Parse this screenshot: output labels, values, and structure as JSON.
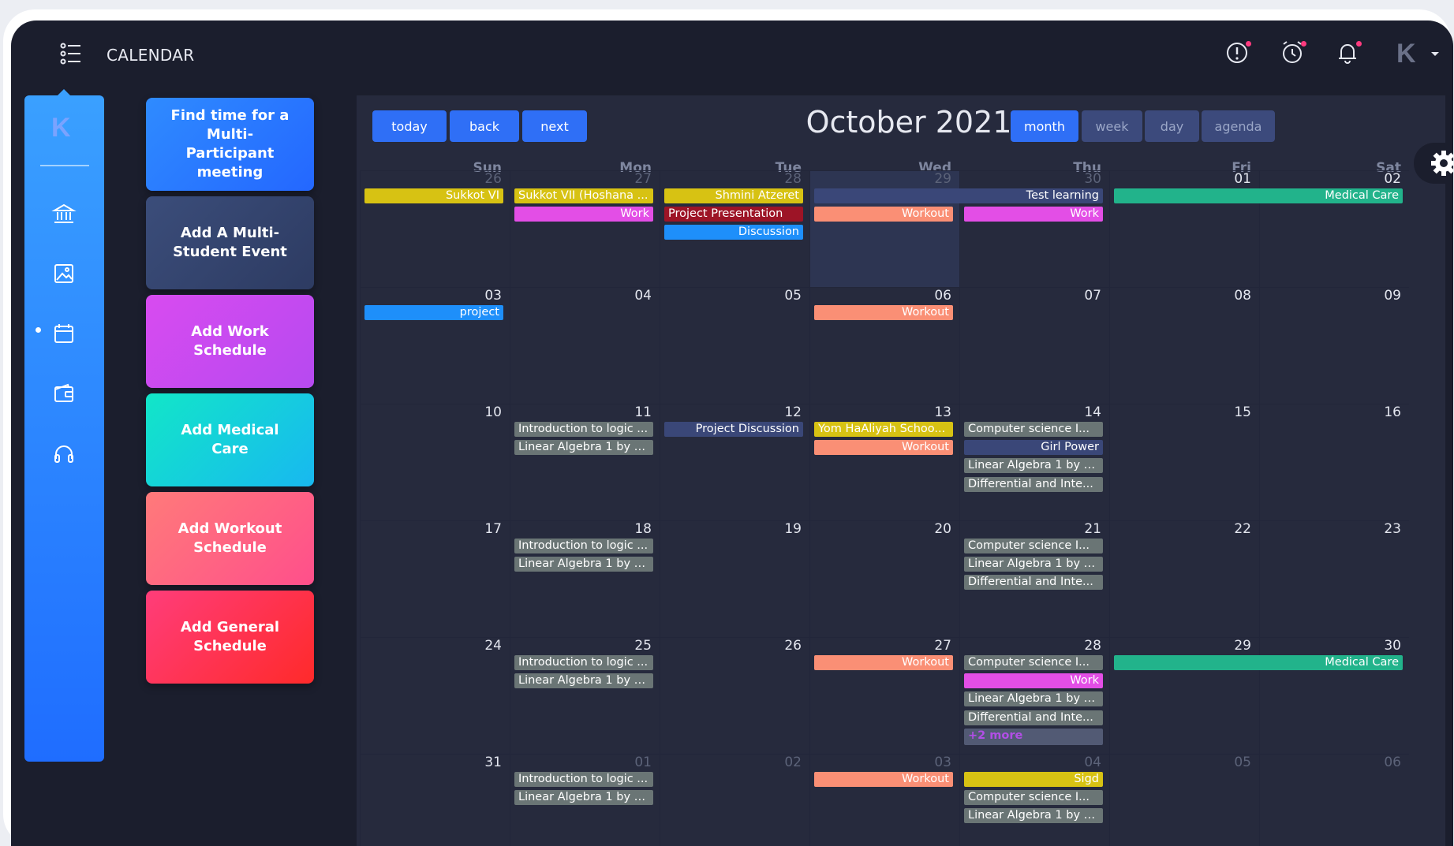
{
  "app": {
    "title": "CALENDAR"
  },
  "header_icons": [
    {
      "name": "alert-icon"
    },
    {
      "name": "alarm-clock-icon"
    },
    {
      "name": "bell-icon"
    }
  ],
  "avatar": {
    "letter": "K"
  },
  "rail": {
    "logo": "K",
    "items": [
      "bank-icon",
      "image-icon",
      "calendar-icon",
      "wallet-icon",
      "headphones-icon"
    ],
    "active_index": 2
  },
  "actions": [
    {
      "label": "Find time for a Multi-Participant meeting",
      "gradient": [
        "#2f8bff",
        "#2467ff"
      ]
    },
    {
      "label": "Add A Multi-Student Event",
      "gradient": [
        "#3b4d7a",
        "#2d3b62"
      ]
    },
    {
      "label": "Add Work Schedule",
      "gradient": [
        "#d84bf0",
        "#b64af0"
      ]
    },
    {
      "label": "Add Medical Care",
      "gradient": [
        "#12e6c8",
        "#18b8f0"
      ]
    },
    {
      "label": "Add Workout Schedule",
      "gradient": [
        "#ff7a7a",
        "#ff4f8b"
      ]
    },
    {
      "label": "Add General Schedule",
      "gradient": [
        "#ff3d7a",
        "#ff2a2a"
      ]
    }
  ],
  "toolbar": {
    "today": "today",
    "back": "back",
    "next": "next",
    "title": "October 2021",
    "views": [
      "month",
      "week",
      "day",
      "agenda"
    ],
    "active_view": "month"
  },
  "weekdays": [
    "Sun",
    "Mon",
    "Tue",
    "Wed",
    "Thu",
    "Fri",
    "Sat"
  ],
  "colors": {
    "holiday": "#d7c213",
    "work": "#e34ee6",
    "workout": "#fa8f75",
    "blue": "#1e8ffa",
    "darkred": "#9d1426",
    "navy": "#3a4778",
    "gray": "#6a7575",
    "teal": "#22b38b",
    "more": "#525a74",
    "more_text": "#b24ee6"
  },
  "weeks": [
    {
      "days": [
        {
          "d": "26",
          "off": true
        },
        {
          "d": "27",
          "off": true
        },
        {
          "d": "28",
          "off": true
        },
        {
          "d": "29",
          "off": true,
          "today": true
        },
        {
          "d": "30",
          "off": true
        },
        {
          "d": "01"
        },
        {
          "d": "02"
        }
      ],
      "events": [
        {
          "t": "Sukkot VI",
          "c": "holiday",
          "s": 0,
          "e": 0,
          "row": 0,
          "a": "r"
        },
        {
          "t": "Sukkot VII (Hoshana ...",
          "c": "holiday",
          "s": 1,
          "e": 1,
          "row": 0,
          "a": "l"
        },
        {
          "t": "Work",
          "c": "work",
          "s": 1,
          "e": 1,
          "row": 1,
          "a": "r"
        },
        {
          "t": "Shmini Atzeret",
          "c": "holiday",
          "s": 2,
          "e": 2,
          "row": 0,
          "a": "r"
        },
        {
          "t": "Project Presentation",
          "c": "darkred",
          "s": 2,
          "e": 2,
          "row": 1,
          "a": "l"
        },
        {
          "t": "Discussion",
          "c": "blue",
          "s": 2,
          "e": 2,
          "row": 2,
          "a": "r"
        },
        {
          "t": "Test learning",
          "c": "navy",
          "s": 3,
          "e": 4,
          "row": 0,
          "a": "r"
        },
        {
          "t": "Workout",
          "c": "workout",
          "s": 3,
          "e": 3,
          "row": 1,
          "a": "r"
        },
        {
          "t": "Work",
          "c": "work",
          "s": 4,
          "e": 4,
          "row": 1,
          "a": "r"
        },
        {
          "t": "Medical Care",
          "c": "teal",
          "s": 5,
          "e": 6,
          "row": 0,
          "a": "r"
        }
      ]
    },
    {
      "days": [
        {
          "d": "03"
        },
        {
          "d": "04"
        },
        {
          "d": "05"
        },
        {
          "d": "06"
        },
        {
          "d": "07"
        },
        {
          "d": "08"
        },
        {
          "d": "09"
        }
      ],
      "events": [
        {
          "t": "project",
          "c": "blue",
          "s": 0,
          "e": 0,
          "row": 0,
          "a": "r"
        },
        {
          "t": "Workout",
          "c": "workout",
          "s": 3,
          "e": 3,
          "row": 0,
          "a": "r"
        }
      ]
    },
    {
      "days": [
        {
          "d": "10"
        },
        {
          "d": "11"
        },
        {
          "d": "12"
        },
        {
          "d": "13"
        },
        {
          "d": "14"
        },
        {
          "d": "15"
        },
        {
          "d": "16"
        }
      ],
      "events": [
        {
          "t": "Introduction to logic ...",
          "c": "gray",
          "s": 1,
          "e": 1,
          "row": 0,
          "a": "l"
        },
        {
          "t": "Linear Algebra 1 by D...",
          "c": "gray",
          "s": 1,
          "e": 1,
          "row": 1,
          "a": "l"
        },
        {
          "t": "Project Discussion",
          "c": "navy",
          "s": 2,
          "e": 2,
          "row": 0,
          "a": "r"
        },
        {
          "t": "Yom HaAliyah Schoo...",
          "c": "holiday",
          "s": 3,
          "e": 3,
          "row": 0,
          "a": "l"
        },
        {
          "t": "Workout",
          "c": "workout",
          "s": 3,
          "e": 3,
          "row": 1,
          "a": "r"
        },
        {
          "t": "Computer science I...",
          "c": "gray",
          "s": 4,
          "e": 4,
          "row": 0,
          "a": "l"
        },
        {
          "t": "Girl Power",
          "c": "navy",
          "s": 4,
          "e": 4,
          "row": 1,
          "a": "r"
        },
        {
          "t": "Linear Algebra 1 by D...",
          "c": "gray",
          "s": 4,
          "e": 4,
          "row": 2,
          "a": "l"
        },
        {
          "t": "Differential and Inte...",
          "c": "gray",
          "s": 4,
          "e": 4,
          "row": 3,
          "a": "l"
        }
      ]
    },
    {
      "days": [
        {
          "d": "17"
        },
        {
          "d": "18"
        },
        {
          "d": "19"
        },
        {
          "d": "20"
        },
        {
          "d": "21"
        },
        {
          "d": "22"
        },
        {
          "d": "23"
        }
      ],
      "events": [
        {
          "t": "Introduction to logic ...",
          "c": "gray",
          "s": 1,
          "e": 1,
          "row": 0,
          "a": "l"
        },
        {
          "t": "Linear Algebra 1 by D...",
          "c": "gray",
          "s": 1,
          "e": 1,
          "row": 1,
          "a": "l"
        },
        {
          "t": "Computer science I...",
          "c": "gray",
          "s": 4,
          "e": 4,
          "row": 0,
          "a": "l"
        },
        {
          "t": "Linear Algebra 1 by D...",
          "c": "gray",
          "s": 4,
          "e": 4,
          "row": 1,
          "a": "l"
        },
        {
          "t": "Differential and Inte...",
          "c": "gray",
          "s": 4,
          "e": 4,
          "row": 2,
          "a": "l"
        }
      ]
    },
    {
      "days": [
        {
          "d": "24"
        },
        {
          "d": "25"
        },
        {
          "d": "26"
        },
        {
          "d": "27"
        },
        {
          "d": "28"
        },
        {
          "d": "29"
        },
        {
          "d": "30"
        }
      ],
      "events": [
        {
          "t": "Introduction to logic ...",
          "c": "gray",
          "s": 1,
          "e": 1,
          "row": 0,
          "a": "l"
        },
        {
          "t": "Linear Algebra 1 by D...",
          "c": "gray",
          "s": 1,
          "e": 1,
          "row": 1,
          "a": "l"
        },
        {
          "t": "Workout",
          "c": "workout",
          "s": 3,
          "e": 3,
          "row": 0,
          "a": "r"
        },
        {
          "t": "Computer science I...",
          "c": "gray",
          "s": 4,
          "e": 4,
          "row": 0,
          "a": "l"
        },
        {
          "t": "Work",
          "c": "work",
          "s": 4,
          "e": 4,
          "row": 1,
          "a": "r"
        },
        {
          "t": "Linear Algebra 1 by D...",
          "c": "gray",
          "s": 4,
          "e": 4,
          "row": 2,
          "a": "l"
        },
        {
          "t": "Differential and Inte...",
          "c": "gray",
          "s": 4,
          "e": 4,
          "row": 3,
          "a": "l"
        },
        {
          "t": "+2 more",
          "c": "more",
          "s": 4,
          "e": 4,
          "row": 4,
          "a": "l",
          "more": true
        },
        {
          "t": "Medical Care",
          "c": "teal",
          "s": 5,
          "e": 6,
          "row": 0,
          "a": "r"
        }
      ]
    },
    {
      "days": [
        {
          "d": "31"
        },
        {
          "d": "01",
          "off": true
        },
        {
          "d": "02",
          "off": true
        },
        {
          "d": "03",
          "off": true
        },
        {
          "d": "04",
          "off": true
        },
        {
          "d": "05",
          "off": true
        },
        {
          "d": "06",
          "off": true
        }
      ],
      "events": [
        {
          "t": "Introduction to logic ...",
          "c": "gray",
          "s": 1,
          "e": 1,
          "row": 0,
          "a": "l"
        },
        {
          "t": "Linear Algebra 1 by D...",
          "c": "gray",
          "s": 1,
          "e": 1,
          "row": 1,
          "a": "l"
        },
        {
          "t": "Workout",
          "c": "workout",
          "s": 3,
          "e": 3,
          "row": 0,
          "a": "r"
        },
        {
          "t": "Sigd",
          "c": "holiday",
          "s": 4,
          "e": 4,
          "row": 0,
          "a": "r"
        },
        {
          "t": "Computer science I...",
          "c": "gray",
          "s": 4,
          "e": 4,
          "row": 1,
          "a": "l"
        },
        {
          "t": "Linear Algebra 1 by D...",
          "c": "gray",
          "s": 4,
          "e": 4,
          "row": 2,
          "a": "l"
        }
      ]
    }
  ]
}
